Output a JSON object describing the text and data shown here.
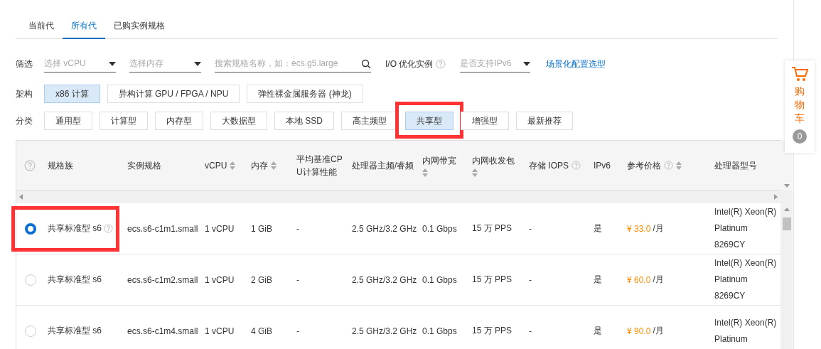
{
  "tabs": [
    {
      "label": "当前代",
      "selected": false
    },
    {
      "label": "所有代",
      "selected": true
    },
    {
      "label": "已购实例规格",
      "selected": false
    }
  ],
  "filters": {
    "label": "筛选",
    "vcpu": {
      "placeholder": "选择 vCPU"
    },
    "memory": {
      "placeholder": "选择内存"
    },
    "search": {
      "placeholder": "搜索规格名称，如：ecs.g5.large"
    },
    "io_label": "I/O 优化实例",
    "ipv6": {
      "placeholder": "是否支持IPv6"
    },
    "link": "场景化配置选型"
  },
  "architecture": {
    "label": "架构",
    "options": [
      {
        "label": "x86 计算",
        "selected": true
      },
      {
        "label": "异构计算 GPU / FPGA / NPU",
        "selected": false
      },
      {
        "label": "弹性裸金属服务器 (神龙)",
        "selected": false
      }
    ]
  },
  "category": {
    "label": "分类",
    "options": [
      {
        "label": "通用型",
        "selected": false,
        "highlighted": false
      },
      {
        "label": "计算型",
        "selected": false,
        "highlighted": false
      },
      {
        "label": "内存型",
        "selected": false,
        "highlighted": false
      },
      {
        "label": "大数据型",
        "selected": false,
        "highlighted": false
      },
      {
        "label": "本地 SSD",
        "selected": false,
        "highlighted": false
      },
      {
        "label": "高主频型",
        "selected": false,
        "highlighted": false
      },
      {
        "label": "共享型",
        "selected": true,
        "highlighted": true
      },
      {
        "label": "增强型",
        "selected": false,
        "highlighted": false
      },
      {
        "label": "最新推荐",
        "selected": false,
        "highlighted": false
      }
    ]
  },
  "table": {
    "columns": [
      {
        "label": "规格族",
        "sortable": false,
        "help": false
      },
      {
        "label": "实例规格",
        "sortable": false,
        "help": false
      },
      {
        "label": "vCPU",
        "sortable": true,
        "help": false
      },
      {
        "label": "内存",
        "sortable": true,
        "help": false
      },
      {
        "label": "平均基准CPU计算性能",
        "sortable": false,
        "help": false
      },
      {
        "label": "处理器主频/睿频",
        "sortable": false,
        "help": false
      },
      {
        "label": "内网带宽",
        "sortable": true,
        "help": false
      },
      {
        "label": "内网收发包",
        "sortable": true,
        "help": false
      },
      {
        "label": "存储 IOPS",
        "sortable": false,
        "help": true
      },
      {
        "label": "IPv6",
        "sortable": false,
        "help": false
      },
      {
        "label": "参考价格",
        "sortable": true,
        "help": true
      },
      {
        "label": "处理器型号",
        "sortable": false,
        "help": false
      }
    ],
    "rows": [
      {
        "selected": true,
        "highlighted": true,
        "family_help": true,
        "cells": [
          "共享标准型 s6",
          "ecs.s6-c1m1.small",
          "1 vCPU",
          "1 GiB",
          "-",
          "2.5 GHz/3.2 GHz",
          "0.1 Gbps",
          "15 万 PPS",
          "-",
          "是"
        ],
        "price": "¥ 33.0",
        "price_unit": "/月",
        "processor": [
          "Intel(R) Xeon(R)",
          "Platinum",
          "8269CY"
        ]
      },
      {
        "selected": false,
        "highlighted": false,
        "family_help": false,
        "cells": [
          "共享标准型 s6",
          "ecs.s6-c1m2.small",
          "1 vCPU",
          "2 GiB",
          "-",
          "2.5 GHz/3.2 GHz",
          "0.1 Gbps",
          "15 万 PPS",
          "-",
          "是"
        ],
        "price": "¥ 60.0",
        "price_unit": "/月",
        "processor": [
          "Intel(R) Xeon(R)",
          "Platinum",
          "8269CY"
        ]
      },
      {
        "selected": false,
        "highlighted": false,
        "family_help": false,
        "cells": [
          "共享标准型 s6",
          "ecs.s6-c1m4.small",
          "1 vCPU",
          "4 GiB",
          "-",
          "2.5 GHz/3.2 GHz",
          "0.1 Gbps",
          "15 万 PPS",
          "-",
          "是"
        ],
        "price": "¥ 90.0",
        "price_unit": "/月",
        "processor": [
          "Intel(R) Xeon(R)",
          "Platinum"
        ]
      }
    ]
  },
  "cart": {
    "label": "购物车",
    "count": "0"
  }
}
